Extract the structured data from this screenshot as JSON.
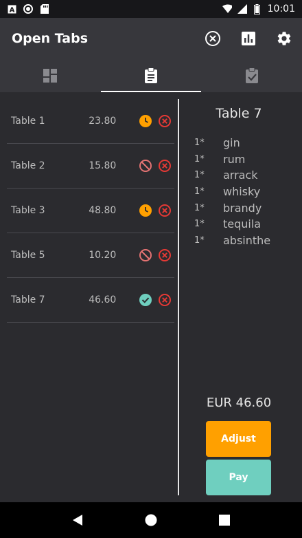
{
  "status_bar": {
    "time": "10:01",
    "left_icons": [
      "text-a-icon",
      "record-icon",
      "sd-card-icon"
    ],
    "right_icons": [
      "wifi-icon",
      "signal-icon",
      "battery-icon"
    ]
  },
  "app_bar": {
    "title": "Open Tabs",
    "actions": [
      "close-circle-icon",
      "chart-icon",
      "gear-icon"
    ]
  },
  "tabs": [
    {
      "icon": "dashboard-icon",
      "active": false
    },
    {
      "icon": "clipboard-icon",
      "active": true
    },
    {
      "icon": "clipboard-check-icon",
      "active": false
    }
  ],
  "tables": [
    {
      "name": "Table 1",
      "amount": "23.80",
      "status": "pending"
    },
    {
      "name": "Table 2",
      "amount": "15.80",
      "status": "blocked"
    },
    {
      "name": "Table 3",
      "amount": "48.80",
      "status": "pending"
    },
    {
      "name": "Table 5",
      "amount": "10.20",
      "status": "blocked"
    },
    {
      "name": "Table 7",
      "amount": "46.60",
      "status": "done"
    }
  ],
  "detail": {
    "title": "Table 7",
    "items": [
      {
        "qty": "1*",
        "name": "gin"
      },
      {
        "qty": "1*",
        "name": "rum"
      },
      {
        "qty": "1*",
        "name": "arrack"
      },
      {
        "qty": "1*",
        "name": "whisky"
      },
      {
        "qty": "1*",
        "name": "brandy"
      },
      {
        "qty": "1*",
        "name": "tequila"
      },
      {
        "qty": "1*",
        "name": "absinthe"
      }
    ],
    "total": "EUR 46.60",
    "adjust_label": "Adjust",
    "pay_label": "Pay"
  },
  "colors": {
    "pending": "#ffa000",
    "blocked": "#e57373",
    "done": "#6fcfbf",
    "delete": "#e53935",
    "adjust": "#ffa000",
    "pay": "#6fcfbf"
  }
}
